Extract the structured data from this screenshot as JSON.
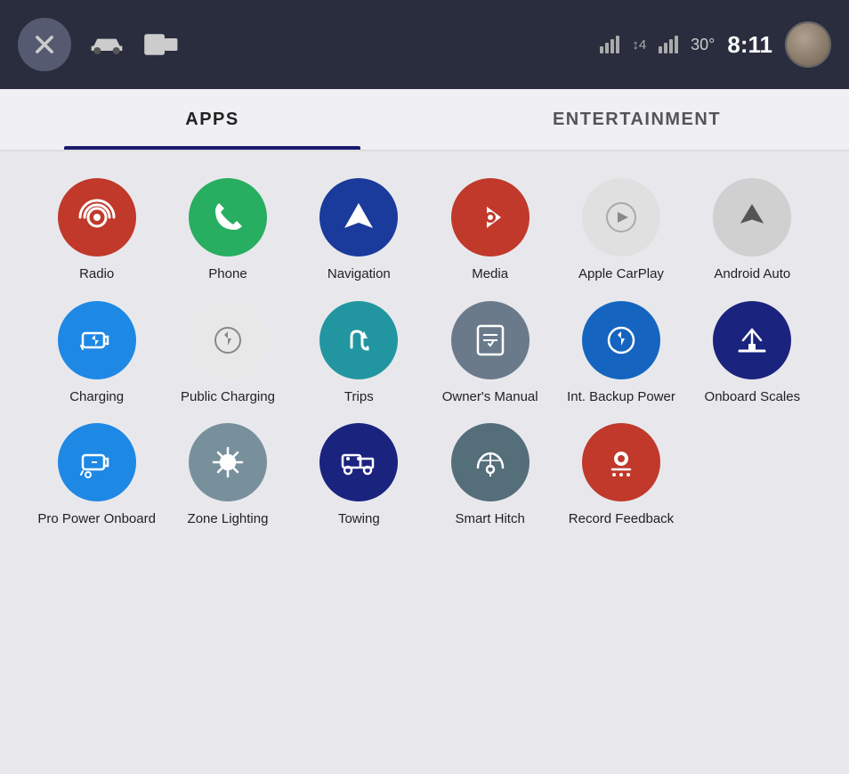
{
  "topbar": {
    "time": "8:11",
    "temperature": "30°",
    "close_label": "close"
  },
  "tabs": [
    {
      "id": "apps",
      "label": "APPS",
      "active": true
    },
    {
      "id": "entertainment",
      "label": "ENTERTAINMENT",
      "active": false
    }
  ],
  "apps": {
    "row1": [
      {
        "id": "radio",
        "label": "Radio",
        "icon": "radio",
        "color": "red"
      },
      {
        "id": "phone",
        "label": "Phone",
        "icon": "phone",
        "color": "green"
      },
      {
        "id": "navigation",
        "label": "Navigation",
        "icon": "navigation",
        "color": "blue-dark"
      },
      {
        "id": "media",
        "label": "Media",
        "icon": "music",
        "color": "red2"
      },
      {
        "id": "apple-carplay",
        "label": "Apple CarPlay",
        "icon": "carplay",
        "color": "light-gray"
      },
      {
        "id": "android-auto",
        "label": "Android Auto",
        "icon": "android",
        "color": "gray"
      }
    ],
    "row2": [
      {
        "id": "charging",
        "label": "Charging",
        "icon": "charging",
        "color": "blue"
      },
      {
        "id": "public-charging",
        "label": "Public Charging",
        "icon": "public-charging",
        "color": "light-gray2"
      },
      {
        "id": "trips",
        "label": "Trips",
        "icon": "trips",
        "color": "blue-teal"
      },
      {
        "id": "owners-manual",
        "label": "Owner's Manual",
        "icon": "book",
        "color": "gray-book"
      },
      {
        "id": "int-backup-power",
        "label": "Int. Backup Power",
        "icon": "backup-power",
        "color": "blue-bright"
      },
      {
        "id": "onboard-scales",
        "label": "Onboard Scales",
        "icon": "scales",
        "color": "navy"
      }
    ],
    "row3": [
      {
        "id": "pro-power-onboard",
        "label": "Pro Power Onboard",
        "icon": "pro-power",
        "color": "blue2"
      },
      {
        "id": "zone-lighting",
        "label": "Zone Lighting",
        "icon": "zone-lighting",
        "color": "gray2"
      },
      {
        "id": "towing",
        "label": "Towing",
        "icon": "towing",
        "color": "navy2"
      },
      {
        "id": "smart-hitch",
        "label": "Smart Hitch",
        "icon": "smart-hitch",
        "color": "teal"
      },
      {
        "id": "record-feedback",
        "label": "Record Feedback",
        "icon": "record",
        "color": "red3"
      },
      {
        "id": "empty",
        "label": "",
        "icon": "",
        "color": ""
      }
    ]
  }
}
